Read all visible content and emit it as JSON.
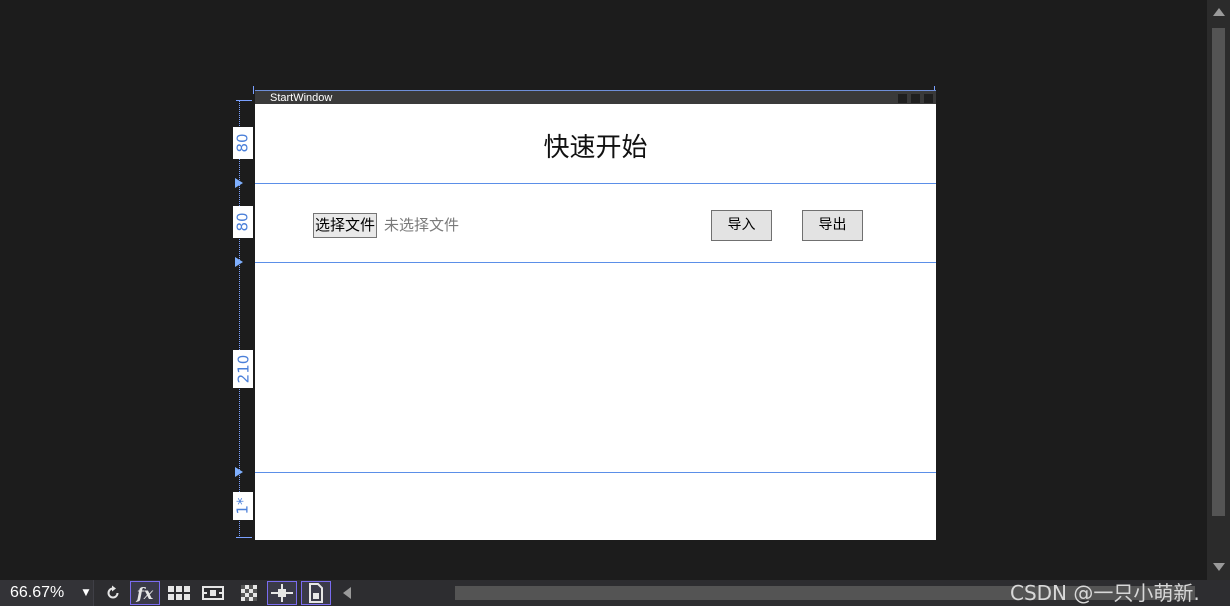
{
  "window": {
    "title": "StartWindow",
    "heading": "快速开始"
  },
  "file_picker": {
    "button_label": "选择文件",
    "status": "未选择文件"
  },
  "actions": {
    "import_label": "导入",
    "export_label": "导出"
  },
  "grid_rows": [
    {
      "label": "80"
    },
    {
      "label": "80"
    },
    {
      "label": "210"
    },
    {
      "label": "1*"
    }
  ],
  "toolbar": {
    "zoom": "66.67%",
    "buttons": [
      {
        "icon": "refresh-icon"
      },
      {
        "icon": "fx-icon",
        "text": "fx"
      },
      {
        "icon": "grid-icon"
      },
      {
        "icon": "device-icon"
      },
      {
        "icon": "checkerboard-icon"
      },
      {
        "icon": "snap-icon"
      },
      {
        "icon": "document-icon"
      }
    ]
  },
  "watermark": "CSDN @一只小萌新.",
  "colors": {
    "canvas": "#1c1c1c",
    "grid_line": "#5b8fe8",
    "row_label": "#4a7fd9",
    "selected_border": "#7a6cf0"
  }
}
